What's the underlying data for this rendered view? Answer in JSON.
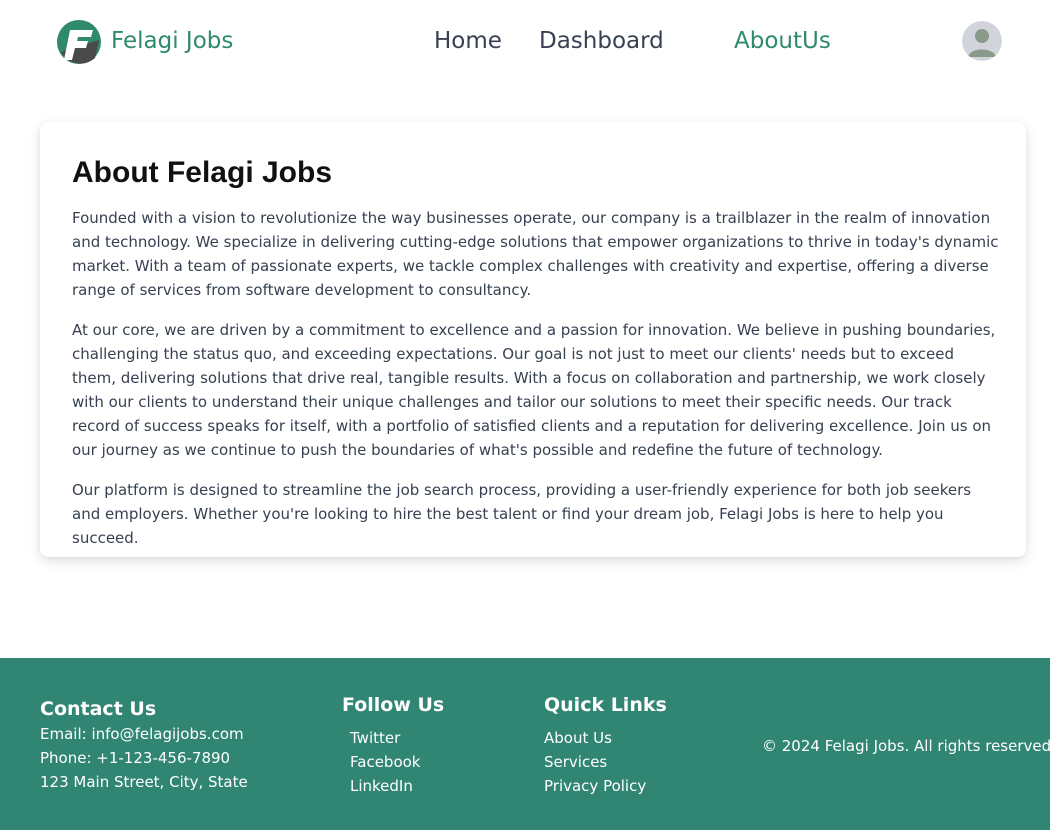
{
  "header": {
    "brand": "Felagi Jobs",
    "nav": {
      "home": "Home",
      "dashboard": "Dashboard",
      "about": "AboutUs"
    },
    "accent_color": "#2f8a6a"
  },
  "main": {
    "title": "About Felagi Jobs",
    "paragraphs": [
      "Founded with a vision to revolutionize the way businesses operate, our company is a trailblazer in the realm of innovation and technology. We specialize in delivering cutting-edge solutions that empower organizations to thrive in today's dynamic market. With a team of passionate experts, we tackle complex challenges with creativity and expertise, offering a diverse range of services from software development to consultancy.",
      "At our core, we are driven by a commitment to excellence and a passion for innovation. We believe in pushing boundaries, challenging the status quo, and exceeding expectations. Our goal is not just to meet our clients' needs but to exceed them, delivering solutions that drive real, tangible results. With a focus on collaboration and partnership, we work closely with our clients to understand their unique challenges and tailor our solutions to meet their specific needs. Our track record of success speaks for itself, with a portfolio of satisfied clients and a reputation for delivering excellence. Join us on our journey as we continue to push the boundaries of what's possible and redefine the future of technology.",
      "Our platform is designed to streamline the job search process, providing a user-friendly experience for both job seekers and employers. Whether you're looking to hire the best talent or find your dream job, Felagi Jobs is here to help you succeed."
    ]
  },
  "footer": {
    "background": "#318573",
    "contact": {
      "heading": "Contact Us",
      "email": "Email: info@felagijobs.com",
      "phone": "Phone: +1-123-456-7890",
      "address": "123 Main Street, City, State"
    },
    "follow": {
      "heading": "Follow Us",
      "links": [
        "Twitter",
        "Facebook",
        "LinkedIn"
      ]
    },
    "quick_links": {
      "heading": "Quick Links",
      "links": [
        "About Us",
        "Services",
        "Privacy Policy"
      ]
    },
    "copyright": "© 2024 Felagi Jobs. All rights reserved."
  }
}
